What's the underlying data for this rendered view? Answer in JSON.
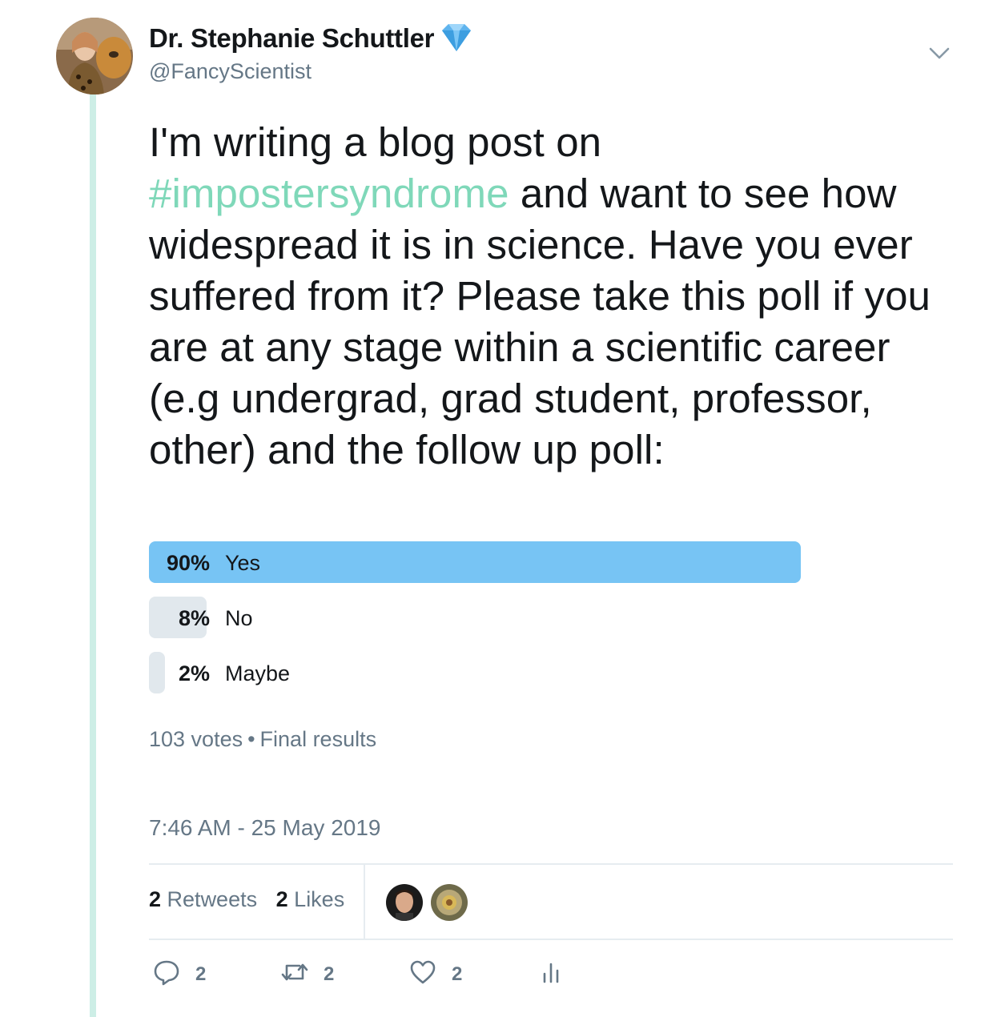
{
  "author": {
    "display_name": "Dr. Stephanie Schuttler",
    "handle": "@FancyScientist",
    "badge_icon": "diamond-icon"
  },
  "tweet": {
    "text_before": "I'm writing a blog post on ",
    "hashtag": "#impostersyndrome",
    "text_after": " and want to see how widespread it is in science. Have you ever suffered from it? Please take this poll if you are at any stage within a scientific career (e.g undergrad, grad student, professor, other) and the follow up poll:"
  },
  "poll": {
    "options": [
      {
        "percent": "90%",
        "label": "Yes",
        "fraction": 0.9
      },
      {
        "percent": "8%",
        "label": "No",
        "fraction": 0.08
      },
      {
        "percent": "2%",
        "label": "Maybe",
        "fraction": 0.02
      }
    ],
    "votes": "103 votes",
    "separator": "•",
    "status": "Final results"
  },
  "timestamp": "7:46 AM - 25 May 2019",
  "stats": {
    "retweets_count": "2",
    "retweets_label": "Retweets",
    "likes_count": "2",
    "likes_label": "Likes"
  },
  "actions": {
    "reply_count": "2",
    "retweet_count": "2",
    "like_count": "2"
  },
  "colors": {
    "accent_hashtag": "#7fd8b9",
    "poll_winner": "#77c4f4",
    "poll_other": "#e1e8ed",
    "secondary_text": "#657786",
    "thread_line": "#cdeee6"
  }
}
